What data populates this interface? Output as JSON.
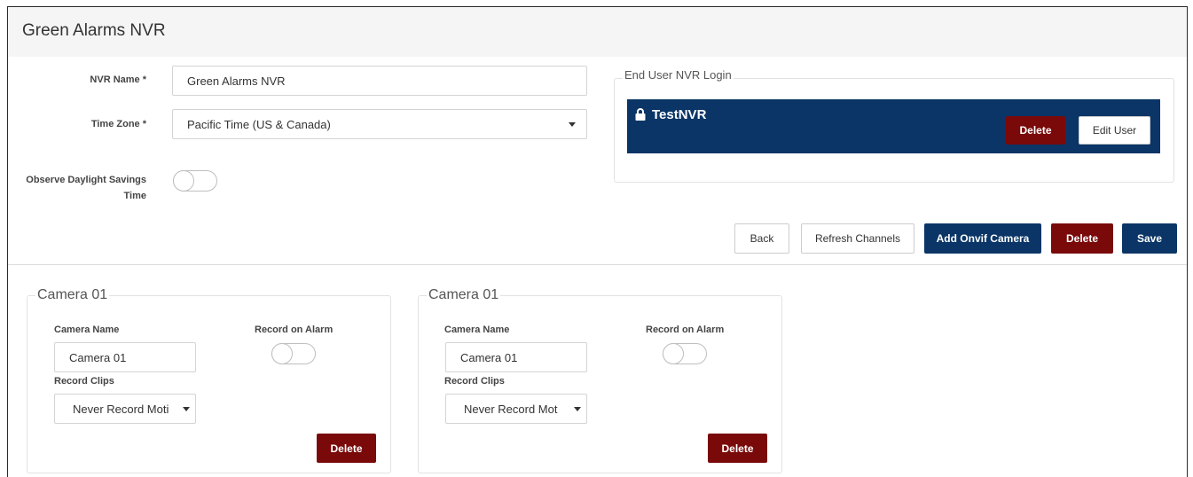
{
  "header": {
    "title": "Green Alarms NVR"
  },
  "nvr_form": {
    "name_label": "NVR Name *",
    "name_value": "Green Alarms NVR",
    "timezone_label": "Time Zone *",
    "timezone_value": "Pacific Time (US & Canada)",
    "dst_label_line1": "Observe Daylight Savings",
    "dst_label_line2": "Time",
    "dst_enabled": false
  },
  "end_user_login": {
    "legend": "End User NVR Login",
    "username": "TestNVR",
    "delete_label": "Delete",
    "edit_label": "Edit User"
  },
  "actions": {
    "back_label": "Back",
    "refresh_label": "Refresh Channels",
    "add_camera_label": "Add Onvif Camera",
    "delete_label": "Delete",
    "save_label": "Save"
  },
  "cameras": [
    {
      "legend": "Camera 01",
      "name_label": "Camera Name",
      "name_value": "Camera 01",
      "record_alarm_label": "Record on Alarm",
      "record_alarm_enabled": false,
      "record_clips_label": "Record Clips",
      "record_clips_value": "Never Record Moti",
      "delete_label": "Delete"
    },
    {
      "legend": "Camera 01",
      "name_label": "Camera Name",
      "name_value": "Camera 01",
      "record_alarm_label": "Record on Alarm",
      "record_alarm_enabled": false,
      "record_clips_label": "Record Clips",
      "record_clips_value": "Never Record Mot",
      "delete_label": "Delete"
    }
  ],
  "colors": {
    "navy": "#0a3566",
    "dark_red": "#7a0a0a"
  }
}
